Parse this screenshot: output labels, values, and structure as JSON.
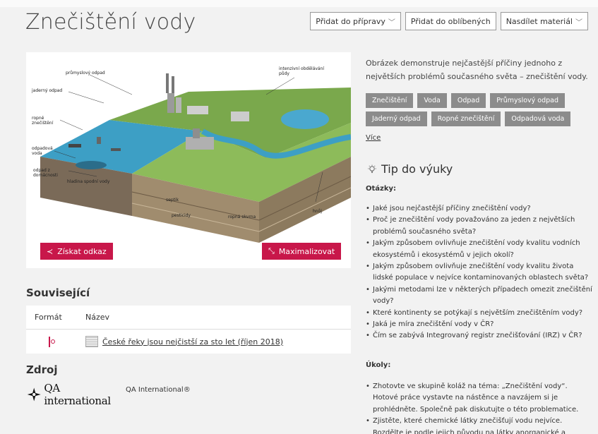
{
  "page": {
    "title": "Znečištění vody"
  },
  "actions": {
    "add_to_prep": "Přidat do přípravy",
    "add_to_favorites": "Přidat do oblíbených",
    "share": "Nasdílet materiál"
  },
  "image": {
    "labels": {
      "industrial_waste": "průmyslový odpad",
      "intensive_farming": "intenzivní obdělávání půdy",
      "nuclear_waste": "jaderný odpad",
      "oil_pollution": "ropné znečištění",
      "waste_water": "odpadová voda",
      "household_waste": "odpad z domácnosti",
      "groundwater_level": "hladina spodní vody",
      "septic": "septik",
      "pesticides": "pesticidy",
      "oil_slick": "ropná skvrna",
      "manure": "hnůj"
    },
    "get_link": "Získat odkaz",
    "maximize": "Maximalizovat"
  },
  "description": "Obrázek demonstruje nejčastější příčiny jednoho z největších problémů současného světa – znečištění vody.",
  "tags": [
    "Znečištění",
    "Voda",
    "Odpad",
    "Průmyslový odpad",
    "Jaderný odpad",
    "Ropné znečištění",
    "Odpadová voda"
  ],
  "more_label": "Více",
  "tip": {
    "heading": "Tip do výuky",
    "questions_label": "Otázky:",
    "questions": [
      "Jaké jsou nejčastější příčiny znečištění vody?",
      "Proč je znečištění vody považováno za jeden z největších problémů současného světa?",
      "Jakým způsobem ovlivňuje znečištění vody kvalitu vodních ekosystémů i ekosystémů v jejich okolí?",
      "Jakým způsobem ovlivňuje znečištění vody kvalitu života lidské populace v nejvíce kontaminovaných oblastech světa?",
      "Jakými metodami lze v některých případech omezit znečištění vody?",
      "Které kontinenty se potýkají s největším znečištěním vody?",
      "Jaká je míra znečištění vody v ČR?",
      "Čím se zabývá Integrovaný registr znečišťování (IRZ) v ČR?"
    ],
    "tasks_label": "Úkoly:",
    "tasks": [
      "Zhotovte ve skupině koláž na téma: „Znečištění vody“. Hotové práce vystavte na nástěnce a navzájem si je prohlédněte. Společně pak diskutujte o této problematice.",
      "Zjistěte, které chemické látky znečišťují vodu nejvíce. Rozdělte je podle jejich původu na látky anorganické a organické."
    ]
  },
  "related": {
    "heading": "Související",
    "col_format": "Formát",
    "col_name": "Název",
    "rows": [
      {
        "format_icon": "pdf-icon",
        "name": "České řeky jsou nejčistší za sto let (říjen 2018)"
      }
    ]
  },
  "source": {
    "heading": "Zdroj",
    "logo_text": "QA international",
    "name": "QA International®"
  },
  "colors": {
    "accent": "#c8174a",
    "tag": "#8c8c8c"
  }
}
